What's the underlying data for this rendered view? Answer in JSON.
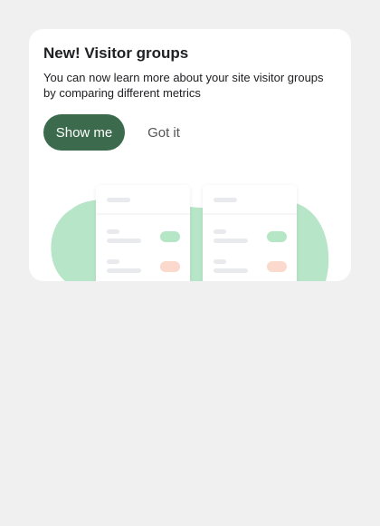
{
  "notification": {
    "title": "New! Visitor groups",
    "description": "You can now learn more about your site visitor groups by comparing different metrics",
    "primary_button_label": "Show me",
    "secondary_button_label": "Got it"
  },
  "illustration": {
    "icon": "visitor-groups-comparison-illustration",
    "blob_color": "#b7e5c8",
    "positive_pill_color": "#b5e6c6",
    "negative_pill_color": "#fbd9cc",
    "placeholder_color": "#e8eaed"
  }
}
